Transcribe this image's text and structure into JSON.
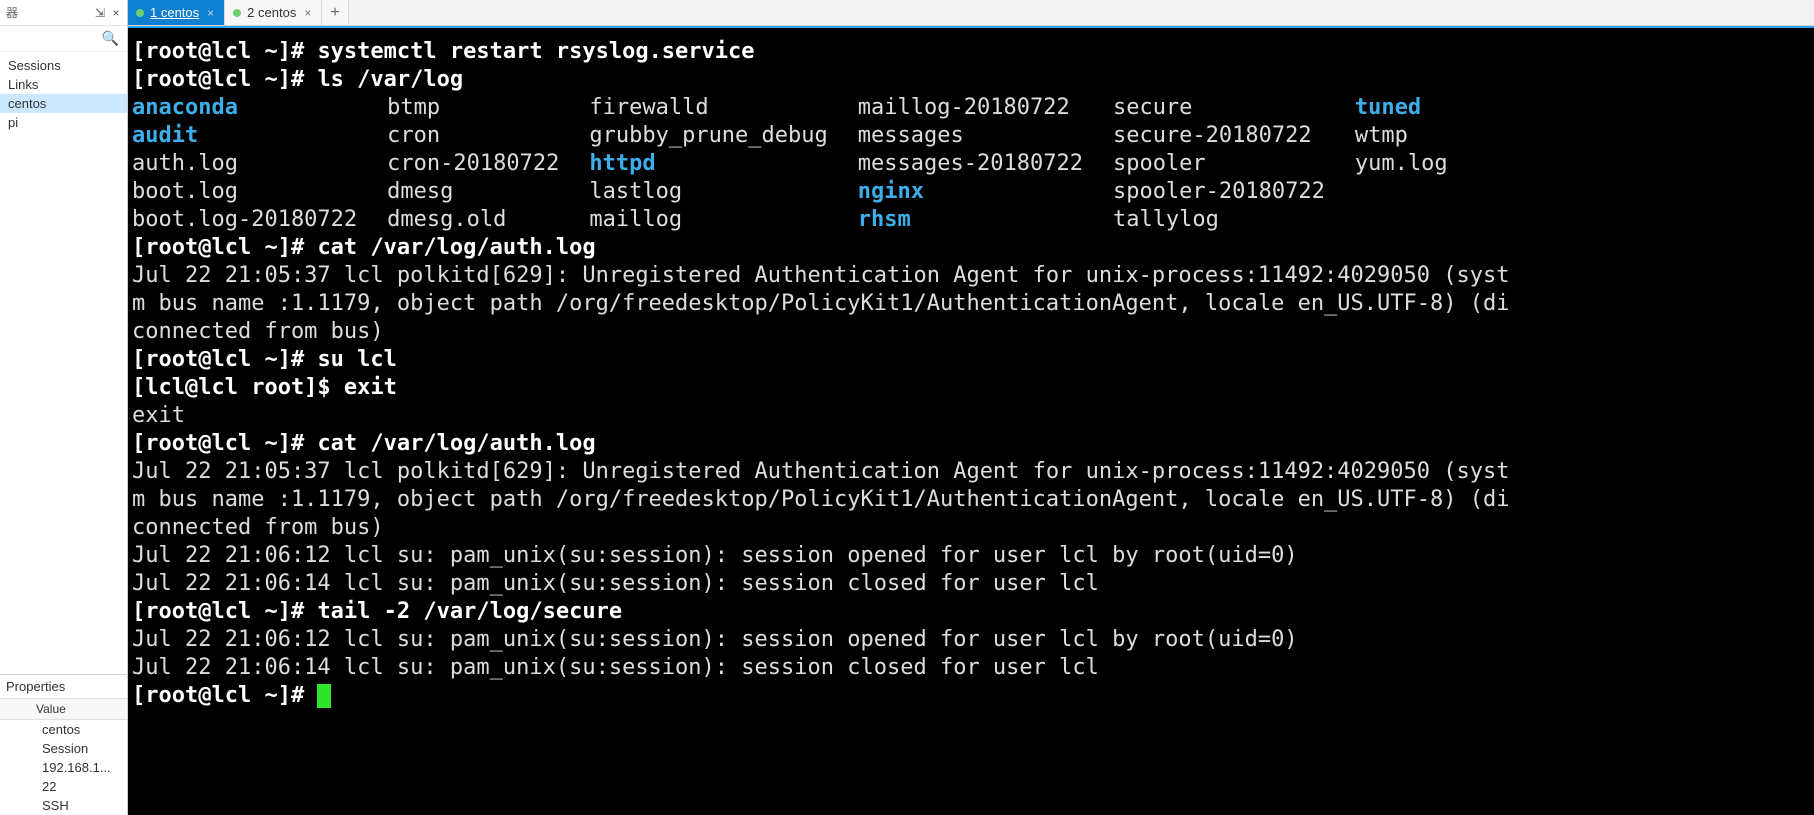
{
  "sidebar": {
    "header": "器",
    "tree": {
      "items": [
        {
          "label": "Sessions"
        },
        {
          "label": "Links"
        },
        {
          "label": "centos",
          "selected": true
        },
        {
          "label": "pi"
        }
      ]
    },
    "properties": {
      "header": "Properties",
      "column": "Value",
      "rows": [
        "centos",
        "Session",
        "192.168.1...",
        "22",
        "SSH"
      ]
    }
  },
  "tabs": [
    {
      "label": "1 centos",
      "active": true
    },
    {
      "label": "2 centos",
      "active": false
    }
  ],
  "add_tab": "+",
  "pin_glyph": "⇲",
  "close_glyph": "×",
  "search_glyph": "🔍",
  "terminal": {
    "prompt_root": "[root@lcl ~]# ",
    "prompt_user": "[lcl@lcl root]$ ",
    "cmd1": "systemctl restart rsyslog.service",
    "cmd2": "ls /var/log",
    "ls": {
      "cols": 6,
      "rows": [
        [
          {
            "t": "anaconda",
            "c": "cyan"
          },
          {
            "t": "btmp"
          },
          {
            "t": "firewalld"
          },
          {
            "t": "maillog-20180722"
          },
          {
            "t": "secure"
          },
          {
            "t": "tuned",
            "c": "cyan"
          }
        ],
        [
          {
            "t": "audit",
            "c": "cyan"
          },
          {
            "t": "cron"
          },
          {
            "t": "grubby_prune_debug"
          },
          {
            "t": "messages"
          },
          {
            "t": "secure-20180722"
          },
          {
            "t": "wtmp"
          }
        ],
        [
          {
            "t": "auth.log"
          },
          {
            "t": "cron-20180722"
          },
          {
            "t": "httpd",
            "c": "cyan"
          },
          {
            "t": "messages-20180722"
          },
          {
            "t": "spooler"
          },
          {
            "t": "yum.log"
          }
        ],
        [
          {
            "t": "boot.log"
          },
          {
            "t": "dmesg"
          },
          {
            "t": "lastlog"
          },
          {
            "t": "nginx",
            "c": "cyan"
          },
          {
            "t": "spooler-20180722"
          },
          {
            "t": ""
          }
        ],
        [
          {
            "t": "boot.log-20180722"
          },
          {
            "t": "dmesg.old"
          },
          {
            "t": "maillog"
          },
          {
            "t": "rhsm",
            "c": "cyan"
          },
          {
            "t": "tallylog"
          },
          {
            "t": ""
          }
        ]
      ]
    },
    "cmd3": "cat /var/log/auth.log",
    "auth1a": "Jul 22 21:05:37 lcl polkitd[629]: Unregistered Authentication Agent for unix-process:11492:4029050 (syst",
    "auth1b": "m bus name :1.1179, object path /org/freedesktop/PolicyKit1/AuthenticationAgent, locale en_US.UTF-8) (di",
    "auth1c": "connected from bus)",
    "cmd4": "su lcl",
    "cmd5": "exit",
    "exit_echo": "exit",
    "cmd6": "cat /var/log/auth.log",
    "auth2a": "Jul 22 21:05:37 lcl polkitd[629]: Unregistered Authentication Agent for unix-process:11492:4029050 (syst",
    "auth2b": "m bus name :1.1179, object path /org/freedesktop/PolicyKit1/AuthenticationAgent, locale en_US.UTF-8) (di",
    "auth2c": "connected from bus)",
    "auth2d": "Jul 22 21:06:12 lcl su: pam_unix(su:session): session opened for user lcl by root(uid=0)",
    "auth2e": "Jul 22 21:06:14 lcl su: pam_unix(su:session): session closed for user lcl",
    "cmd7": "tail -2 /var/log/secure",
    "sec1": "Jul 22 21:06:12 lcl su: pam_unix(su:session): session opened for user lcl by root(uid=0)",
    "sec2": "Jul 22 21:06:14 lcl su: pam_unix(su:session): session closed for user lcl"
  }
}
